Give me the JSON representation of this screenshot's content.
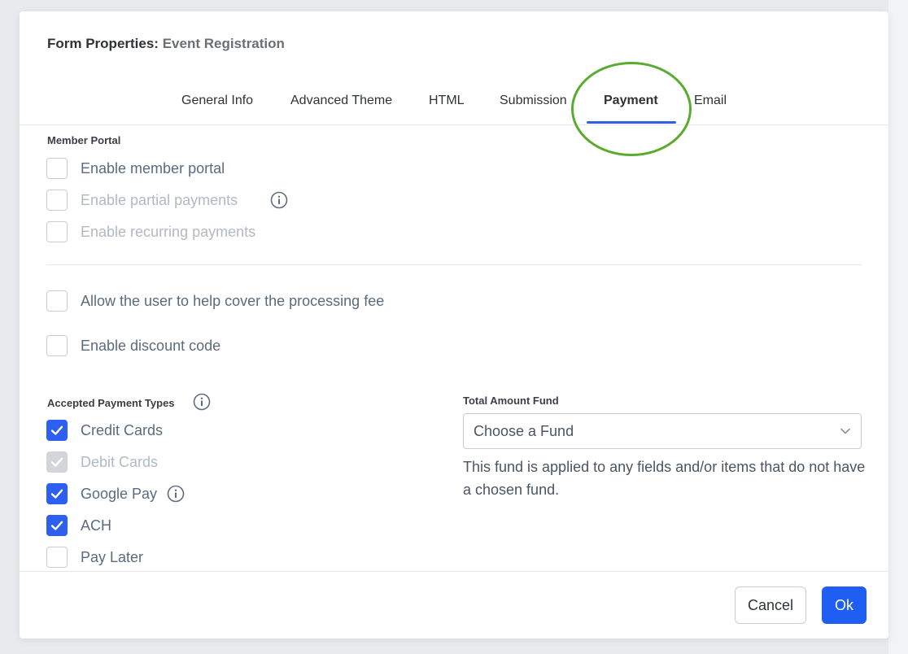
{
  "modal": {
    "title_prefix": "Form Properties:",
    "title_name": "Event Registration"
  },
  "tabs": [
    {
      "label": "General Info"
    },
    {
      "label": "Advanced Theme"
    },
    {
      "label": "HTML"
    },
    {
      "label": "Submission"
    },
    {
      "label": "Payment",
      "active": true
    },
    {
      "label": "Email"
    }
  ],
  "member_portal": {
    "label": "Member Portal",
    "options": [
      {
        "label": "Enable member portal",
        "checked": false,
        "disabled": false
      },
      {
        "label": "Enable partial payments",
        "checked": false,
        "disabled": true,
        "info": "info-icon"
      },
      {
        "label": "Enable recurring payments",
        "checked": false,
        "disabled": true
      }
    ]
  },
  "fees": {
    "cover_fee_label": "Allow the user to help cover the processing fee",
    "discount_label": "Enable discount code"
  },
  "payment_types": {
    "label": "Accepted Payment Types",
    "options": [
      {
        "label": "Credit Cards",
        "checked": true
      },
      {
        "label": "Debit Cards",
        "checked": true,
        "disabled": true
      },
      {
        "label": "Google Pay",
        "checked": true,
        "info": "info-icon"
      },
      {
        "label": "ACH",
        "checked": true
      },
      {
        "label": "Pay Later",
        "checked": false
      }
    ]
  },
  "fund": {
    "label": "Total Amount Fund",
    "selected": "Choose a Fund",
    "help": "This fund is applied to any fields and/or items that do not have a chosen fund."
  },
  "footer": {
    "cancel_label": "Cancel",
    "ok_label": "Ok"
  },
  "colors": {
    "accent": "#2d5ff0",
    "highlight_ring": "#5aab2e"
  }
}
